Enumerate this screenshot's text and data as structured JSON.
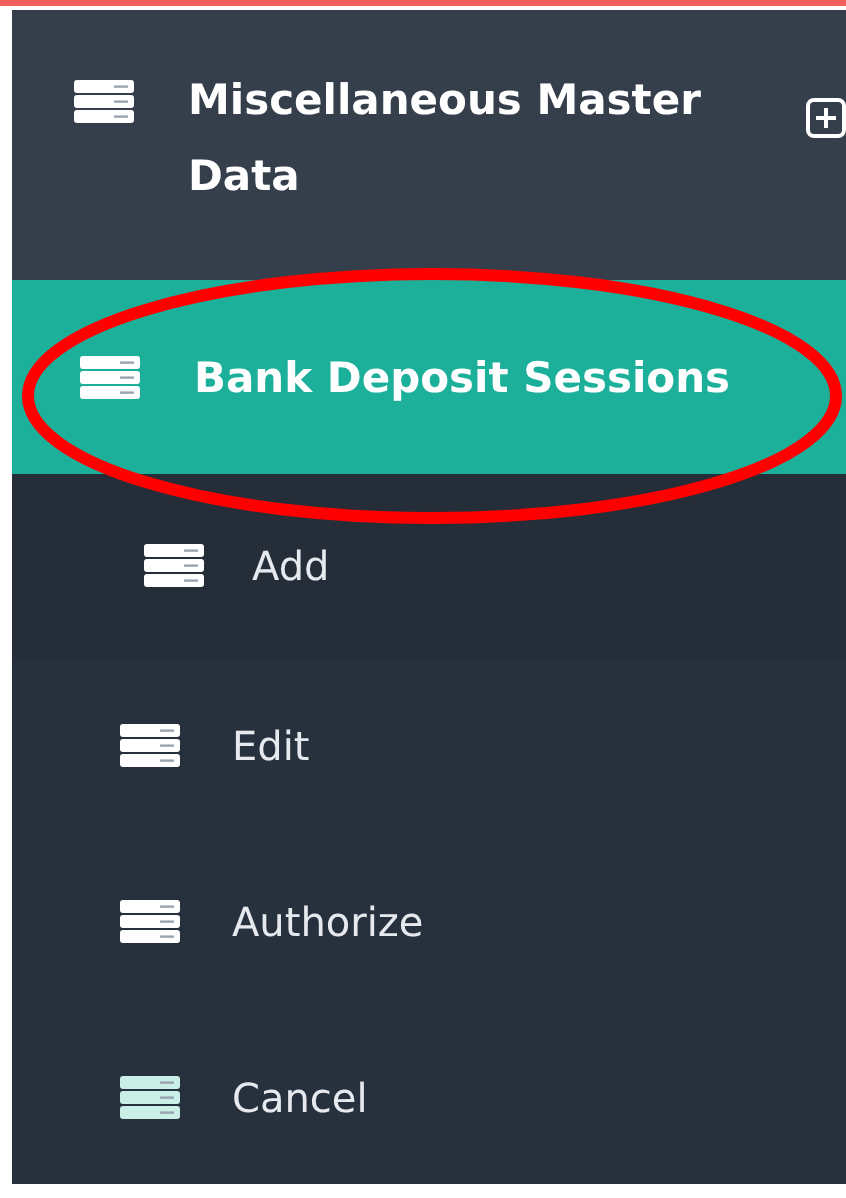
{
  "header": {
    "label": "Miscellaneous Master Data",
    "expandable": true
  },
  "items": [
    {
      "label": "Bank Deposit Sessions",
      "selected": true,
      "circled": true,
      "hovered": false,
      "children": [
        {
          "label": "Add",
          "selected": false
        }
      ]
    },
    {
      "label": "Edit",
      "selected": false,
      "circled": false,
      "hovered": false
    },
    {
      "label": "Authorize",
      "selected": false,
      "circled": false,
      "hovered": false
    },
    {
      "label": "Cancel",
      "selected": false,
      "circled": false,
      "hovered": true
    }
  ]
}
